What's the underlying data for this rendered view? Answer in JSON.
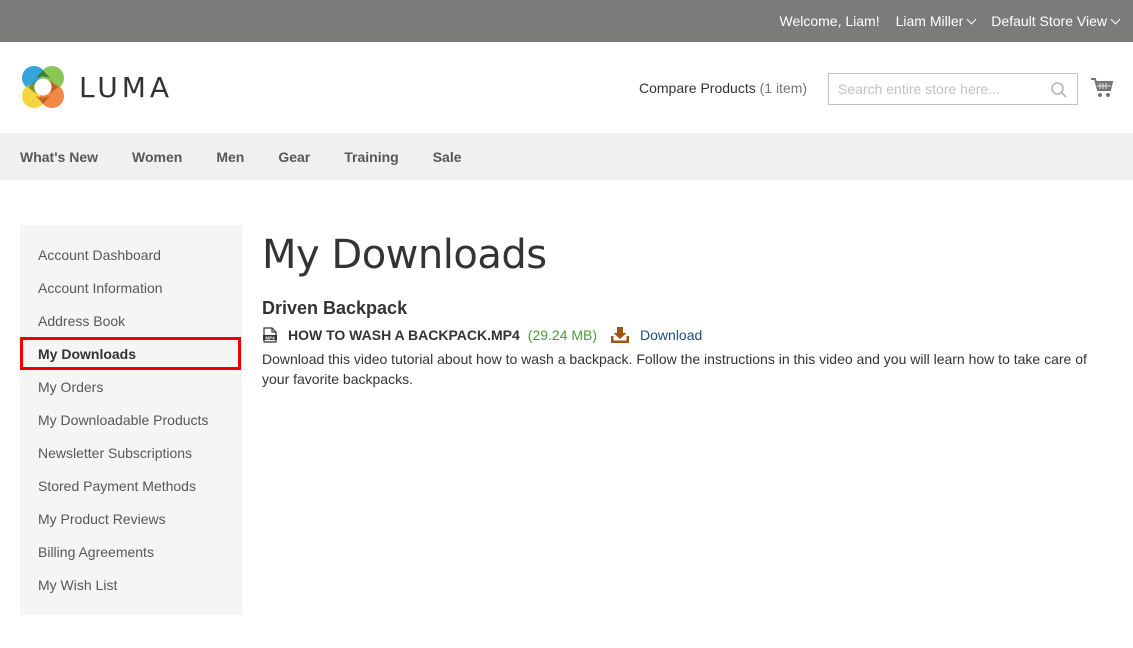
{
  "topbar": {
    "welcome": "Welcome, Liam!",
    "account_name": "Liam Miller",
    "store_view": "Default Store View"
  },
  "header": {
    "logo_text": "LUMA",
    "compare_label": "Compare Products",
    "compare_count": "(1 item)",
    "search_placeholder": "Search entire store here..."
  },
  "nav": {
    "items": [
      "What's New",
      "Women",
      "Men",
      "Gear",
      "Training",
      "Sale"
    ]
  },
  "sidebar": {
    "items": [
      {
        "label": "Account Dashboard"
      },
      {
        "label": "Account Information"
      },
      {
        "label": "Address Book"
      },
      {
        "label": "My Downloads",
        "active": true
      },
      {
        "label": "My Orders"
      },
      {
        "label": "My Downloadable Products"
      },
      {
        "label": "Newsletter Subscriptions"
      },
      {
        "label": "Stored Payment Methods"
      },
      {
        "label": "My Product Reviews"
      },
      {
        "label": "Billing Agreements"
      },
      {
        "label": "My Wish List"
      }
    ]
  },
  "main": {
    "title": "My Downloads",
    "product_name": "Driven Backpack",
    "file": {
      "name": "HOW TO WASH A BACKPACK.MP4",
      "size": "(29.24 MB)",
      "download_label": "Download",
      "file_icon": "mp4-file-icon",
      "download_icon": "download-tray-icon"
    },
    "description": "Download this video tutorial about how to wash a backpack. Follow the instructions in this video and you will learn how to take care of your favorite backpacks."
  },
  "colors": {
    "topbar_bg": "#7b7c79",
    "nav_bg": "#f0f0f0",
    "sidebar_bg": "#f5f5f5",
    "active_highlight": "#ee0000",
    "file_size": "#4e9a3a",
    "download_icon": "#a0540f",
    "link": "#1f4e79"
  }
}
